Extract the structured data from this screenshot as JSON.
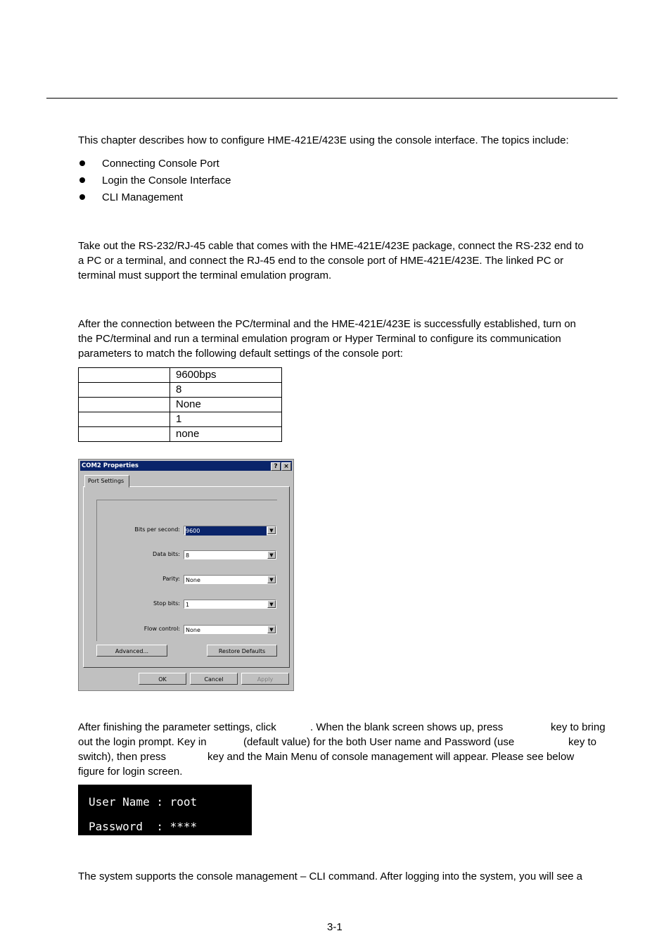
{
  "intro": "This chapter describes how to configure HME-421E/423E using the console interface. The topics include:",
  "topics": [
    "Connecting Console Port",
    "Login the Console Interface",
    "CLI Management"
  ],
  "connect_para": [
    "Take out the RS-232/RJ-45 cable that comes with the HME-421E/423E package, connect the RS-232 end to",
    "a PC or a terminal, and connect the RJ-45 end to the console port of HME-421E/423E. The linked PC or",
    "terminal must support the terminal emulation program."
  ],
  "login_para": [
    "After the connection between the PC/terminal and the HME-421E/423E is successfully established, turn on",
    "the PC/terminal and run a terminal emulation program or Hyper Terminal to configure its communication",
    "parameters to match the following default settings of the console port:"
  ],
  "settings_table": [
    {
      "key": "",
      "value": "9600bps"
    },
    {
      "key": "",
      "value": "8"
    },
    {
      "key": "",
      "value": "None"
    },
    {
      "key": "",
      "value": "1"
    },
    {
      "key": "",
      "value": "none"
    }
  ],
  "dialog": {
    "title": "COM2 Properties",
    "help": "?",
    "close": "×",
    "tab": "Port Settings",
    "fields": [
      {
        "label": "Bits per second:",
        "value": "9600"
      },
      {
        "label": "Data bits:",
        "value": "8"
      },
      {
        "label": "Parity:",
        "value": "None"
      },
      {
        "label": "Stop bits:",
        "value": "1"
      },
      {
        "label": "Flow control:",
        "value": "None"
      }
    ],
    "advanced": "Advanced...",
    "restore": "Restore Defaults",
    "ok": "OK",
    "cancel": "Cancel",
    "apply": "Apply"
  },
  "after_para": {
    "l1a": "After finishing the parameter settings, click",
    "l1b": ". When the blank screen shows up, press",
    "l1c": "key to bring",
    "l2a": "out the login prompt. Key in",
    "l2b": "(default value) for the both User name and Password (use",
    "l2c": "key to",
    "l3a": "switch), then press",
    "l3b": "key and the Main Menu of console management will appear. Please see below",
    "l4": "figure for login screen."
  },
  "terminal": {
    "user_line": "User Name : root",
    "pass_line": "Password  : ****"
  },
  "cli_para": "The system supports the console management – CLI command. After logging into the system, you will see a",
  "page_number": "3-1"
}
